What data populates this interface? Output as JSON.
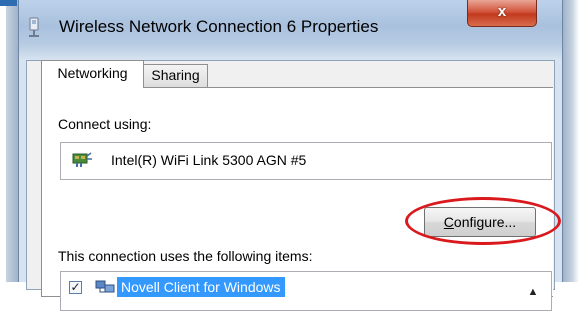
{
  "window": {
    "title": "Wireless Network Connection 6 Properties",
    "close_glyph": "x"
  },
  "tabs": [
    {
      "label": "Networking",
      "selected": true
    },
    {
      "label": "Sharing",
      "selected": false
    }
  ],
  "networking": {
    "connect_using_label": "Connect using:",
    "adapter_name": "Intel(R) WiFi Link 5300 AGN #5",
    "configure_label": "Configure...",
    "items_label": "This connection uses the following items:",
    "items": [
      {
        "label": "Novell Client for Windows",
        "checked": true,
        "selected": true
      }
    ]
  },
  "colors": {
    "selection": "#3399ff",
    "highlight_ellipse": "#d9191c",
    "close_button": "#c23a1e"
  }
}
